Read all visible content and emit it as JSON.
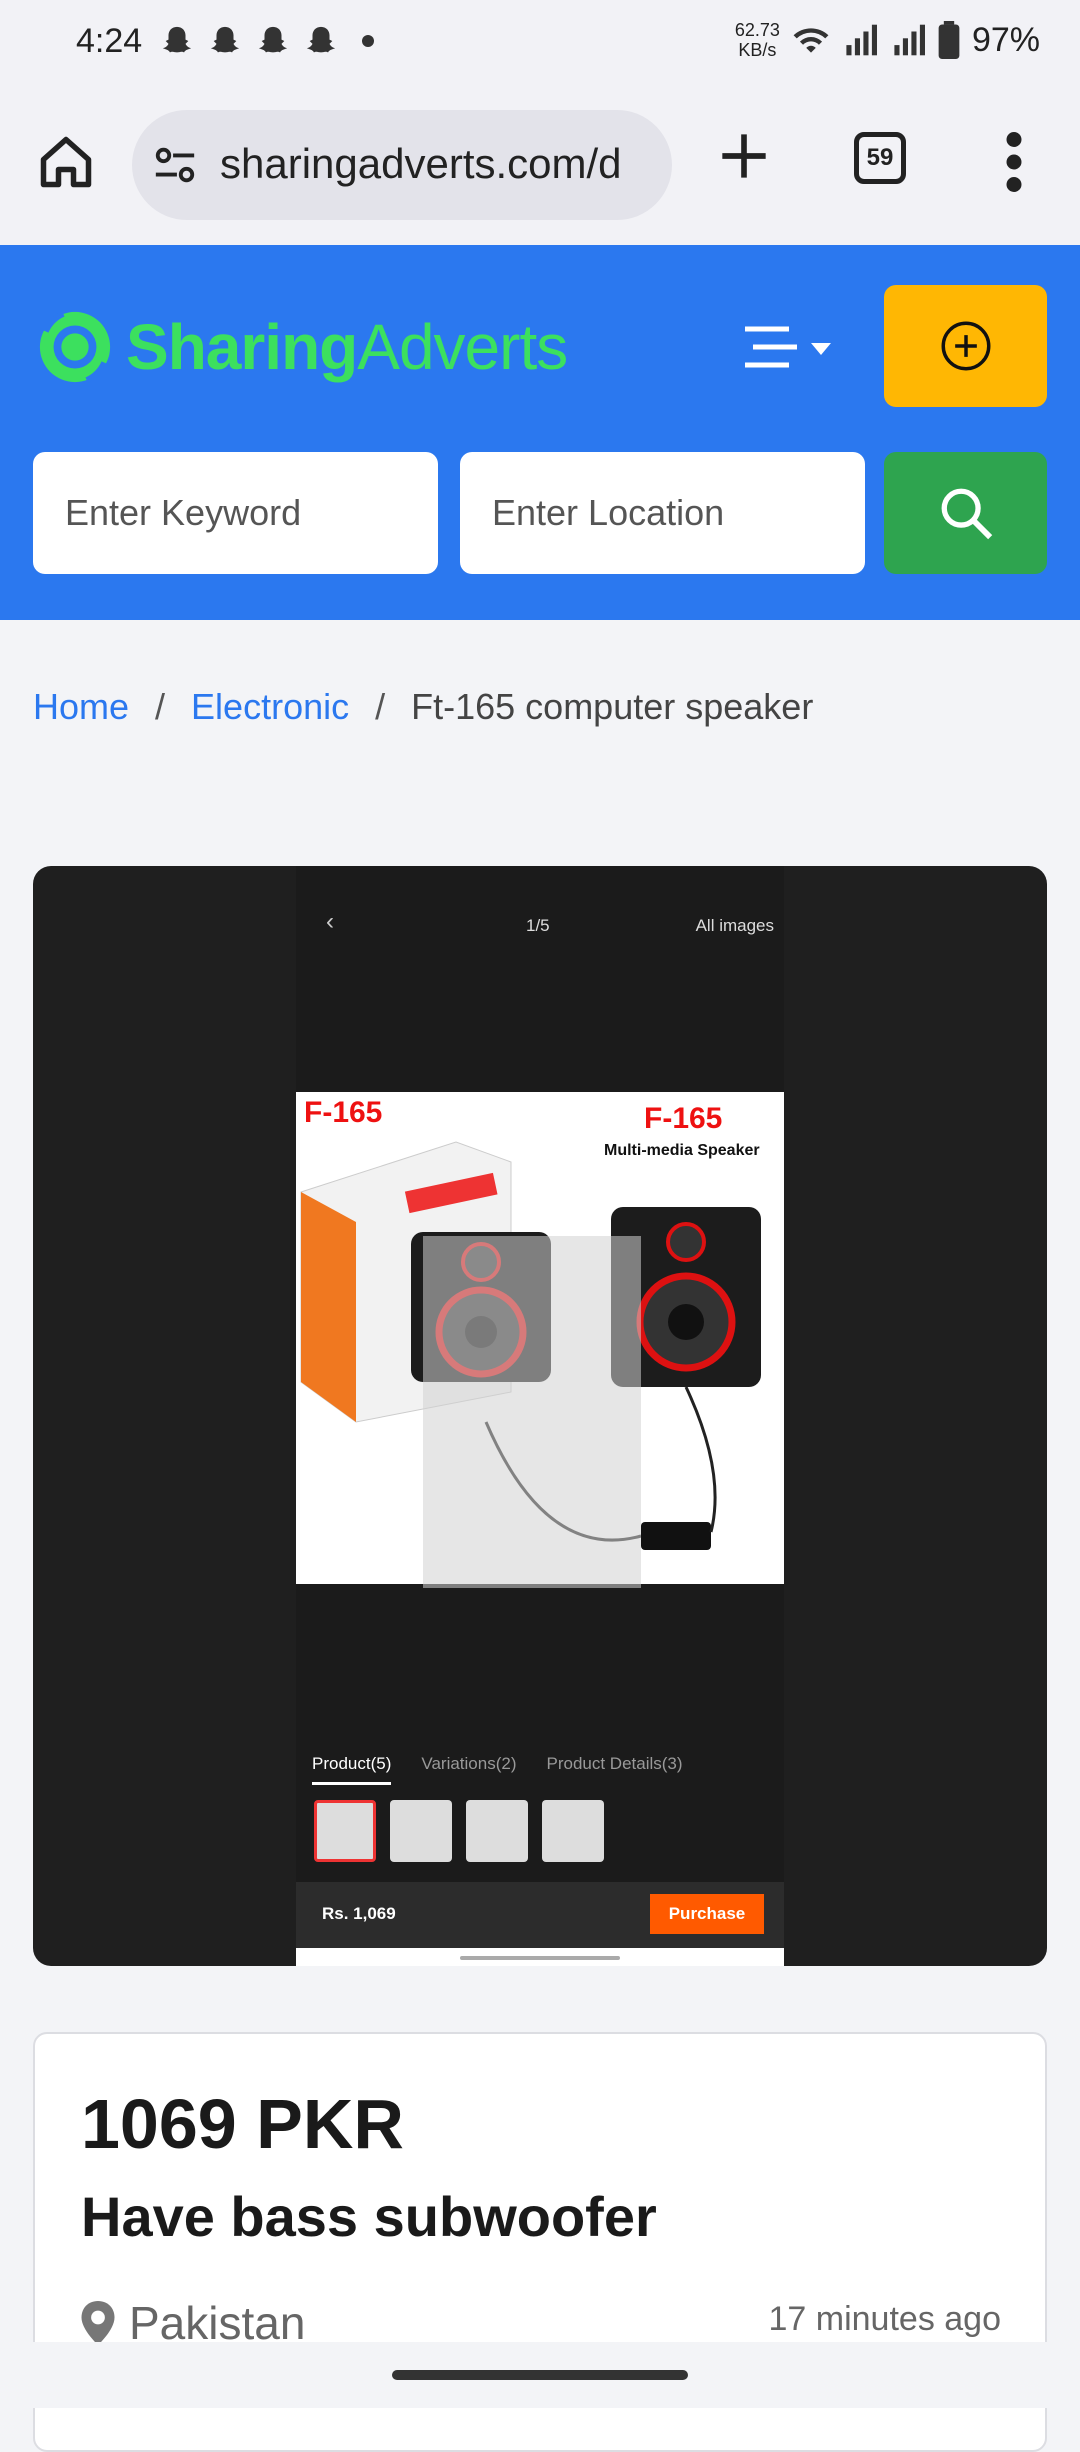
{
  "status_bar": {
    "time": "4:24",
    "net_speed_value": "62.73",
    "net_speed_unit": "KB/s",
    "battery": "97%"
  },
  "browser": {
    "url": "sharingadverts.com/d",
    "tab_count": "59"
  },
  "site": {
    "logo_bold": "Sharing",
    "logo_light": "Adverts",
    "brand_color": "#2b78ef",
    "accent_color": "#ffb703",
    "search": {
      "keyword_placeholder": "Enter Keyword",
      "location_placeholder": "Enter Location"
    }
  },
  "breadcrumb": {
    "home": "Home",
    "sep": "/",
    "category": "Electronic",
    "current": "Ft-165 computer speaker"
  },
  "gallery": {
    "counter": "1/5",
    "all_images": "All images",
    "model_left": "F-165",
    "model_right": "F-165",
    "subtitle": "Multi-media Speaker",
    "tabs": [
      "Product(5)",
      "Variations(2)",
      "Product Details(3)"
    ],
    "price": "Rs. 1,069",
    "purchase": "Purchase"
  },
  "listing": {
    "price": "1069 PKR",
    "title": "Have bass subwoofer",
    "location": "Pakistan",
    "posted": "17 minutes ago"
  }
}
